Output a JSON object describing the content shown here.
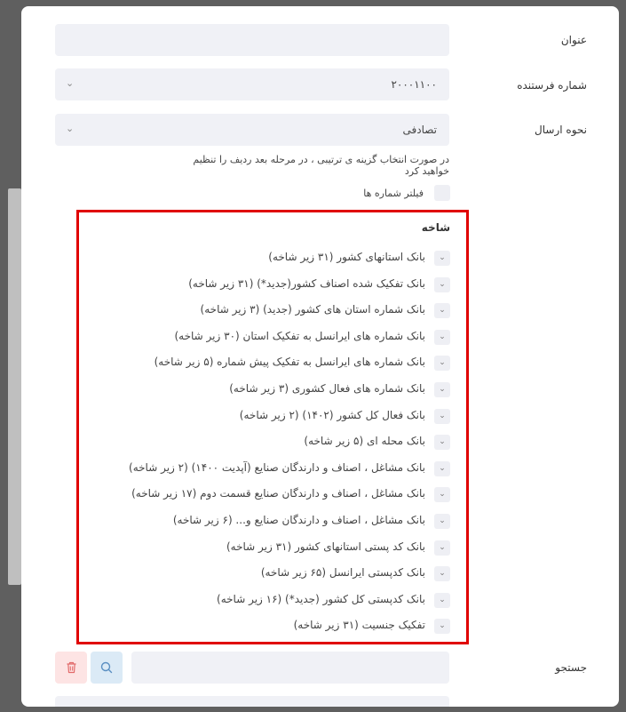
{
  "form": {
    "title_label": "عنوان",
    "title_value": "",
    "sender_label": "شماره فرستنده",
    "sender_value": "۲۰۰۰۱۱۰۰",
    "method_label": "نحوه ارسال",
    "method_value": "تصادفی",
    "hint": "در صورت انتخاب گزینه ی ترتیبی ، در مرحله بعد ردیف را تنظیم خواهید کرد",
    "filter_label": "فیلتر شماره ها"
  },
  "branch": {
    "title": "شاخه",
    "items": [
      "بانک استانهای کشور (۳۱ زیر شاخه)",
      "بانک تفکیک شده اصناف کشور(جدید*) (۳۱ زیر شاخه)",
      "بانک شماره استان های کشور (جدید) (۳ زیر شاخه)",
      "بانک شماره های ایرانسل به تفکیک استان (۳۰ زیر شاخه)",
      "بانک شماره های ایرانسل به تفکیک پیش شماره (۵ زیر شاخه)",
      "بانک شماره های فعال کشوری (۳ زیر شاخه)",
      "بانک فعال کل کشور (۱۴۰۲) (۲ زیر شاخه)",
      "بانک محله ای (۵ زیر شاخه)",
      "بانک مشاغل ، اصناف و دارندگان صنایع (آپدیت ۱۴۰۰) (۲ زیر شاخه)",
      "بانک مشاغل ، اصناف و دارندگان صنایع قسمت دوم (۱۷ زیر شاخه)",
      "بانک مشاغل ، اصناف و دارندگان صنایع و... (۶ زیر شاخه)",
      "بانک کد پستی استانهای کشور (۳۱ زیر شاخه)",
      "بانک کدپستی ایرانسل (۶۵ زیر شاخه)",
      "بانک کدپستی کل کشور (جدید*) (۱۶ زیر شاخه)",
      "تفکیک جنسیت (۳۱ زیر شاخه)"
    ]
  },
  "search": {
    "label": "جستجو",
    "value": ""
  },
  "icons": {
    "chevron": "chevron-down-icon",
    "search": "search-icon",
    "delete": "trash-icon"
  },
  "colors": {
    "highlight_border": "#e00000",
    "field_bg": "#f0f1f6",
    "search_btn_bg": "#dbeaf6",
    "delete_btn_bg": "#fde4e4"
  }
}
